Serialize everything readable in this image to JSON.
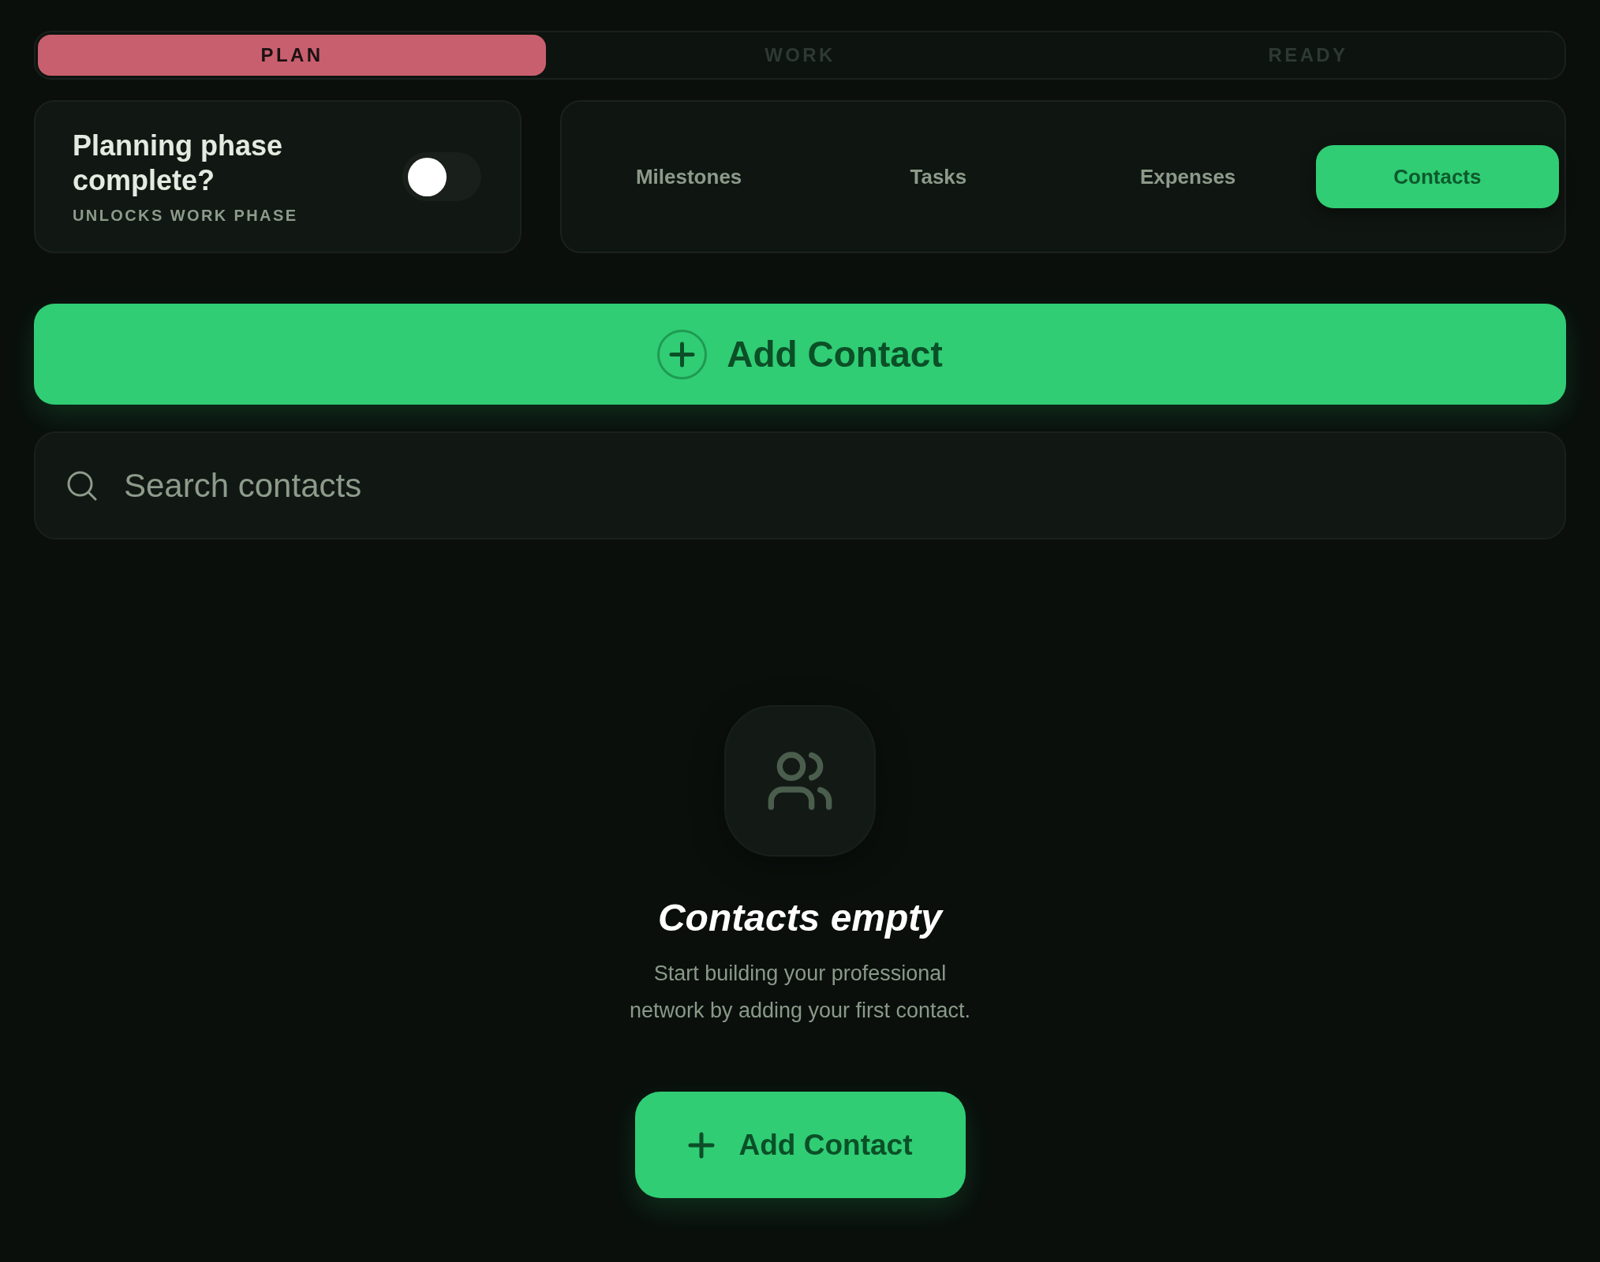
{
  "phases": [
    {
      "label": "PLAN",
      "selected": true
    },
    {
      "label": "WORK",
      "selected": false
    },
    {
      "label": "READY",
      "selected": false
    }
  ],
  "phase_toggle": {
    "title": "Planning phase complete?",
    "subtitle": "UNLOCKS WORK PHASE",
    "on": false
  },
  "tabs": [
    {
      "label": "Milestones",
      "selected": false
    },
    {
      "label": "Tasks",
      "selected": false
    },
    {
      "label": "Expenses",
      "selected": false
    },
    {
      "label": "Contacts",
      "selected": true
    }
  ],
  "add_button": {
    "label": "Add Contact"
  },
  "search": {
    "placeholder": "Search contacts"
  },
  "empty_state": {
    "title": "Contacts empty",
    "message": "Start building your professional network by adding your first contact.",
    "button": "Add Contact"
  }
}
